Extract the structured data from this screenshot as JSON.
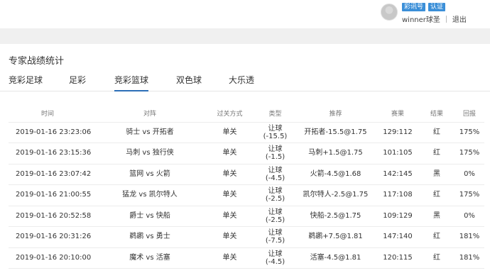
{
  "header": {
    "badges": [
      "彩讯号",
      "认证"
    ],
    "username": "winner球圣",
    "logout": "退出"
  },
  "panel": {
    "title": "专家战绩统计",
    "tabs": [
      "竞彩足球",
      "足彩",
      "竞彩篮球",
      "双色球",
      "大乐透"
    ],
    "active_tab": "竞彩篮球"
  },
  "table": {
    "headers": [
      "时间",
      "对阵",
      "过关方式",
      "类型",
      "推荐",
      "赛果",
      "结果",
      "回报"
    ],
    "rows": [
      {
        "time": "2019-01-16 23:23:06",
        "match": "骑士 vs 开拓者",
        "pass": "单关",
        "type": "让球",
        "handicap": "(-15.5)",
        "pick": "开拓者-15.5@1.75",
        "score": "129:112",
        "result": "红",
        "return": "175%"
      },
      {
        "time": "2019-01-16 23:15:36",
        "match": "马刺 vs 独行侠",
        "pass": "单关",
        "type": "让球",
        "handicap": "(-1.5)",
        "pick": "马刺+1.5@1.75",
        "score": "101:105",
        "result": "红",
        "return": "175%"
      },
      {
        "time": "2019-01-16 23:07:42",
        "match": "篮网 vs 火箭",
        "pass": "单关",
        "type": "让球",
        "handicap": "(-4.5)",
        "pick": "火箭-4.5@1.68",
        "score": "142:145",
        "result": "黑",
        "return": "0%"
      },
      {
        "time": "2019-01-16 21:00:55",
        "match": "猛龙 vs 凯尔特人",
        "pass": "单关",
        "type": "让球",
        "handicap": "(-2.5)",
        "pick": "凯尔特人-2.5@1.75",
        "score": "117:108",
        "result": "红",
        "return": "175%"
      },
      {
        "time": "2019-01-16 20:52:58",
        "match": "爵士 vs 快船",
        "pass": "单关",
        "type": "让球",
        "handicap": "(-2.5)",
        "pick": "快船-2.5@1.75",
        "score": "109:129",
        "result": "黑",
        "return": "0%"
      },
      {
        "time": "2019-01-16 20:31:26",
        "match": "鹈鹕 vs 勇士",
        "pass": "单关",
        "type": "让球",
        "handicap": "(-7.5)",
        "pick": "鹈鹕+7.5@1.81",
        "score": "147:140",
        "result": "红",
        "return": "181%"
      },
      {
        "time": "2019-01-16 20:10:00",
        "match": "魔术 vs 活塞",
        "pass": "单关",
        "type": "让球",
        "handicap": "(-4.5)",
        "pick": "活塞-4.5@1.81",
        "score": "120:115",
        "result": "红",
        "return": "181%"
      }
    ]
  }
}
